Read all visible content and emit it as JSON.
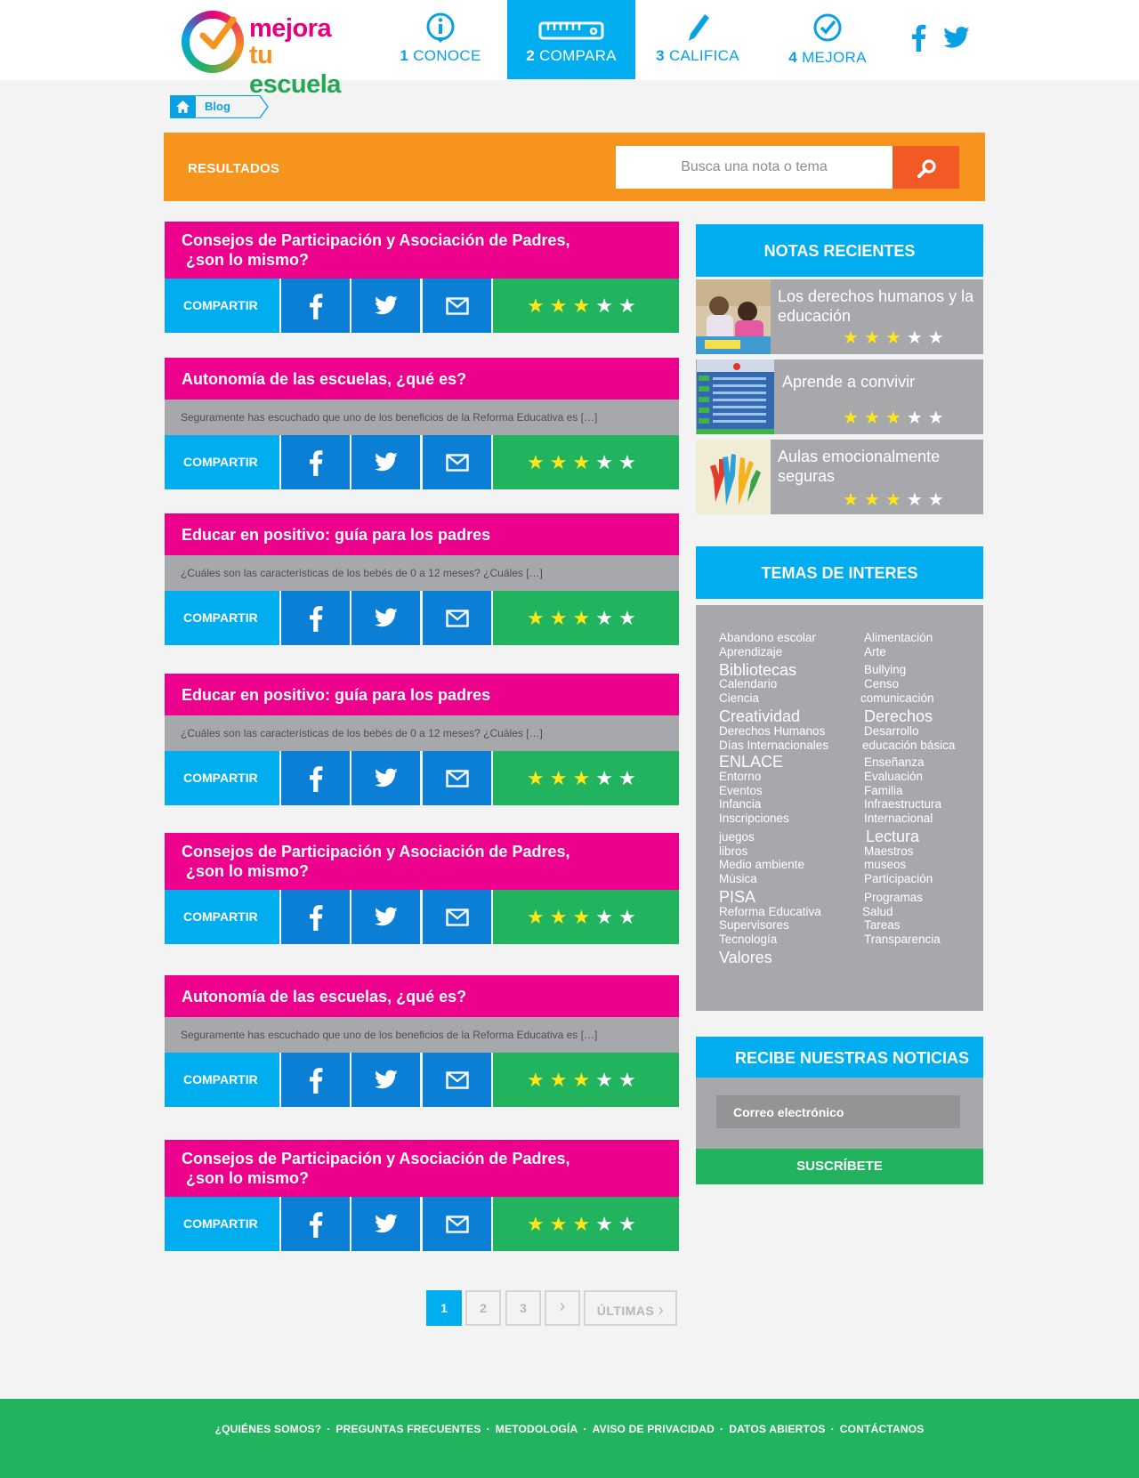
{
  "header": {
    "logo": {
      "line1": "mejora",
      "line2a": "tu",
      "line2b": "escuela"
    },
    "nav": [
      {
        "num": "1",
        "label": "CONOCE",
        "icon": "info-icon",
        "active": false
      },
      {
        "num": "2",
        "label": "COMPARA",
        "icon": "ruler-icon",
        "active": true
      },
      {
        "num": "3",
        "label": "CALIFICA",
        "icon": "pencil-icon",
        "active": false
      },
      {
        "num": "4",
        "label": "MEJORA",
        "icon": "check-circle-icon",
        "active": false
      }
    ],
    "social": [
      "facebook-icon",
      "twitter-icon"
    ]
  },
  "breadcrumb": {
    "home_icon": "home-icon",
    "label": "Blog"
  },
  "results": {
    "title": "RESULTADOS",
    "search_placeholder": "Busca una nota o tema",
    "search_icon": "search-icon"
  },
  "share_label": "COMPARTIR",
  "posts": [
    {
      "title_l1": "Consejos de Participación y Asociación de Padres,",
      "title_l2": " ¿son lo mismo?",
      "excerpt": "",
      "rating": 3
    },
    {
      "title_l1": "Autonomía de las escuelas, ¿qué es?",
      "title_l2": "",
      "excerpt": "Seguramente has escuchado que uno de los beneficios de la Reforma Educativa es […]",
      "rating": 3
    },
    {
      "title_l1": "Educar en positivo: guía para los padres",
      "title_l2": "",
      "excerpt": "¿Cuáles son las características de los bebés de 0 a 12 meses? ¿Cuáles […]",
      "rating": 3
    },
    {
      "title_l1": "Educar en positivo: guía para los padres",
      "title_l2": "",
      "excerpt": "¿Cuáles son las características de los bebés de 0 a 12 meses? ¿Cuáles […]",
      "rating": 3
    },
    {
      "title_l1": "Consejos de Participación y Asociación de Padres,",
      "title_l2": " ¿son lo mismo?",
      "excerpt": "",
      "rating": 3
    },
    {
      "title_l1": "Autonomía de las escuelas, ¿qué es?",
      "title_l2": "",
      "excerpt": "Seguramente has escuchado que uno de los beneficios de la Reforma Educativa es […]",
      "rating": 3
    },
    {
      "title_l1": "Consejos de Participación y Asociación de Padres,",
      "title_l2": " ¿son lo mismo?",
      "excerpt": "",
      "rating": 3
    }
  ],
  "sidebar": {
    "recent_title": "NOTAS RECIENTES",
    "recent": [
      {
        "title": "Los derechos humanos y la educación",
        "rating": 3
      },
      {
        "title": "Aprende  a convivir",
        "rating": 3
      },
      {
        "title": "Aulas emocionalmente seguras",
        "rating": 3
      }
    ],
    "topics_title": "TEMAS DE INTERES",
    "topics": [
      "Abandono escolar",
      "Alimentación",
      "Aprendizaje",
      "Arte",
      "Bibliotecas",
      "Bullying",
      "Calendario",
      "Censo",
      "Ciencia",
      "comunicación",
      "Creatividad",
      "Derechos",
      "Derechos Humanos",
      "Desarrollo",
      "Días Internacionales",
      "educación básica",
      "ENLACE",
      "Enseñanza",
      "Entorno",
      "Evaluación",
      "Eventos",
      "Familia",
      "Infancia",
      "Infraestructura",
      "Inscripciones",
      "Internacional",
      "juegos",
      "Lectura",
      "libros",
      "Maestros",
      "Medio ambiente",
      "museos",
      "Música",
      "Participación",
      "PISA",
      "Programas",
      "Reforma Educativa",
      "Salud",
      "Supervisores",
      "Tareas",
      "Tecnología",
      "Transparencia",
      "Valores"
    ],
    "newsletter_title": "RECIBE NUESTRAS NOTICIAS",
    "email_placeholder": "Correo electrónico",
    "subscribe_label": "SUSCRÍBETE"
  },
  "pagination": {
    "pages": [
      "1",
      "2",
      "3"
    ],
    "next": "›",
    "last": "ÚLTIMAS",
    "current": "1"
  },
  "footer": [
    "¿QUIÉNES SOMOS?",
    "PREGUNTAS FRECUENTES",
    "METODOLOGÍA",
    "AVISO DE PRIVACIDAD",
    "DATOS ABIERTOS",
    "CONTÁCTANOS"
  ],
  "colors": {
    "magenta": "#ec008c",
    "cyan": "#00aeef",
    "orange": "#f7941d",
    "green": "#22b35e",
    "gray": "#a7a8ab",
    "blue": "#0b7fd6"
  }
}
